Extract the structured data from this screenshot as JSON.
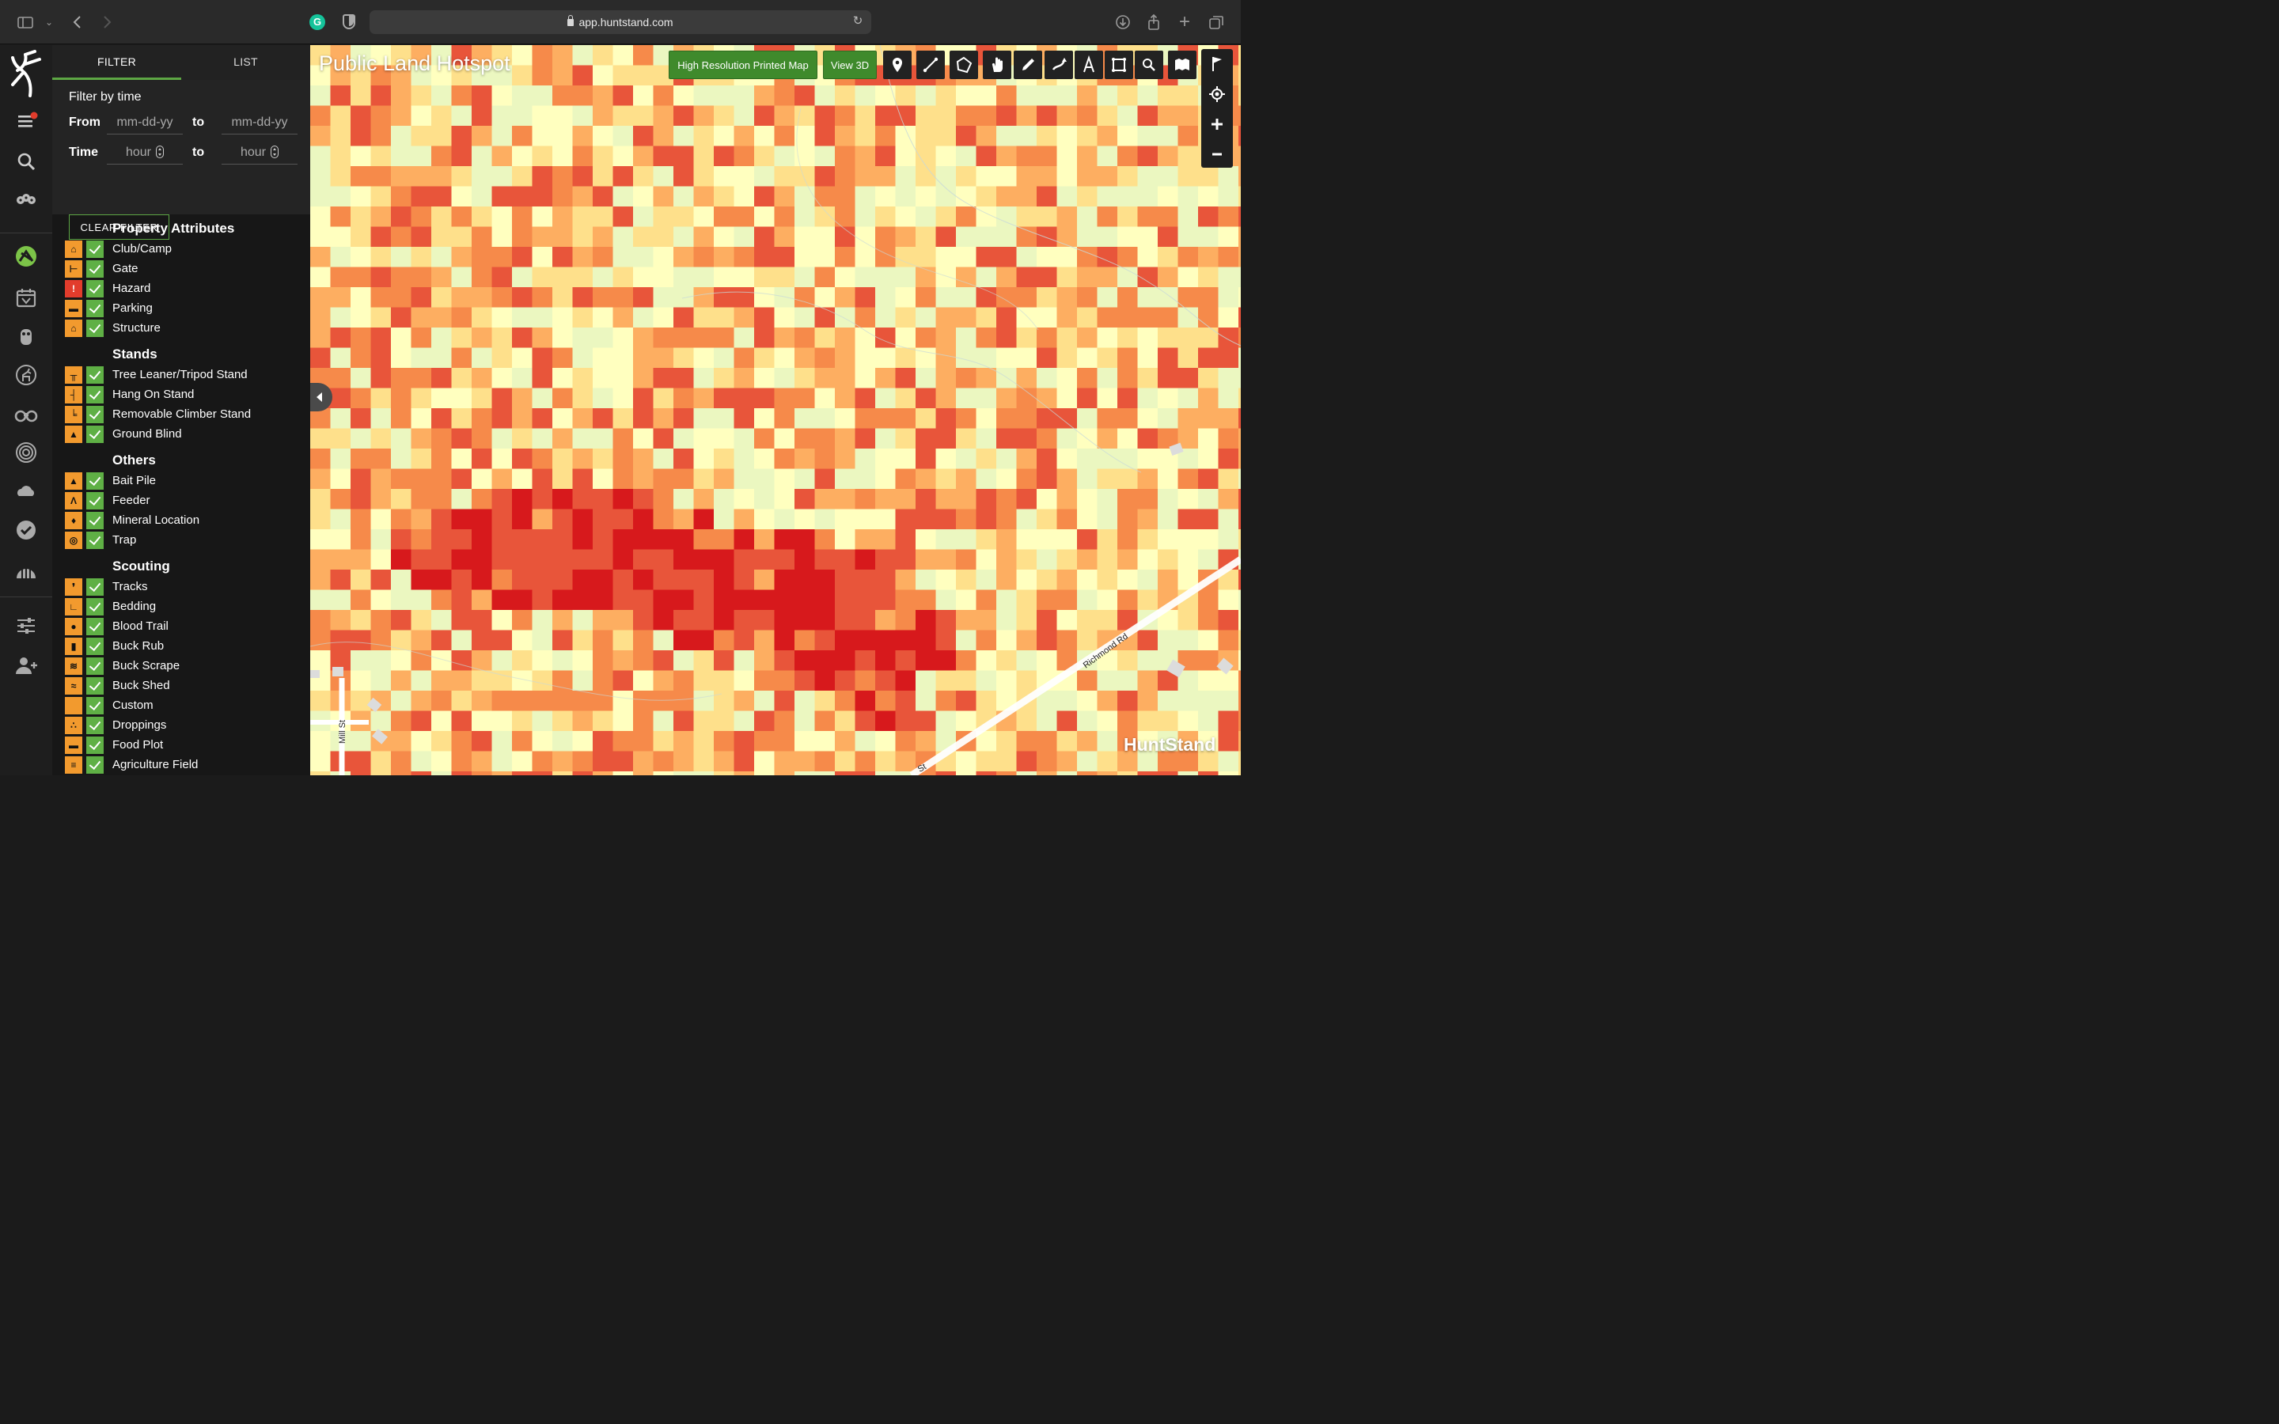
{
  "browser": {
    "url": "app.huntstand.com"
  },
  "panel": {
    "tabs": [
      "FILTER",
      "LIST"
    ],
    "time_filter": {
      "heading": "Filter by time",
      "from_label": "From",
      "to_label": "to",
      "time_label": "Time",
      "date_placeholder": "mm-dd-yy",
      "hour_placeholder": "hour",
      "clear_label": "CLEAR FILTER"
    },
    "categories": [
      {
        "title": "Property Attributes",
        "items": [
          {
            "label": "Club/Camp",
            "icon": "camp-icon"
          },
          {
            "label": "Gate",
            "icon": "gate-icon"
          },
          {
            "label": "Hazard",
            "icon": "hazard-icon"
          },
          {
            "label": "Parking",
            "icon": "parking-icon"
          },
          {
            "label": "Structure",
            "icon": "structure-icon"
          }
        ]
      },
      {
        "title": "Stands",
        "items": [
          {
            "label": "Tree Leaner/Tripod Stand",
            "icon": "tripod-stand-icon"
          },
          {
            "label": "Hang On Stand",
            "icon": "hang-on-stand-icon"
          },
          {
            "label": "Removable Climber Stand",
            "icon": "climber-stand-icon"
          },
          {
            "label": "Ground Blind",
            "icon": "ground-blind-icon"
          }
        ]
      },
      {
        "title": "Others",
        "items": [
          {
            "label": "Bait Pile",
            "icon": "bait-pile-icon"
          },
          {
            "label": "Feeder",
            "icon": "feeder-icon"
          },
          {
            "label": "Mineral Location",
            "icon": "mineral-icon"
          },
          {
            "label": "Trap",
            "icon": "trap-icon"
          }
        ]
      },
      {
        "title": "Scouting",
        "items": [
          {
            "label": "Tracks",
            "icon": "tracks-icon"
          },
          {
            "label": "Bedding",
            "icon": "bedding-icon"
          },
          {
            "label": "Blood Trail",
            "icon": "blood-trail-icon"
          },
          {
            "label": "Buck Rub",
            "icon": "buck-rub-icon"
          },
          {
            "label": "Buck Scrape",
            "icon": "buck-scrape-icon"
          },
          {
            "label": "Buck Shed",
            "icon": "buck-shed-icon"
          },
          {
            "label": "Custom",
            "icon": "custom-icon"
          },
          {
            "label": "Droppings",
            "icon": "droppings-icon"
          },
          {
            "label": "Food Plot",
            "icon": "food-plot-icon"
          },
          {
            "label": "Agriculture Field",
            "icon": "agriculture-field-icon"
          }
        ]
      }
    ]
  },
  "map": {
    "title": "Public Land Hotspot",
    "print_button": "High Resolution Printed Map",
    "view3d_button": "View 3D",
    "roads": {
      "richmond": "Richmond Rd",
      "mill": "Mill St",
      "st": "St"
    },
    "logo": "HuntStand",
    "colors": {
      "hot": "#d7191c",
      "warm": "#fdae61",
      "neutral": "#ffffbf",
      "cool": "#abdda4",
      "cold": "#2b83ba",
      "accent_green": "#5da744"
    }
  }
}
